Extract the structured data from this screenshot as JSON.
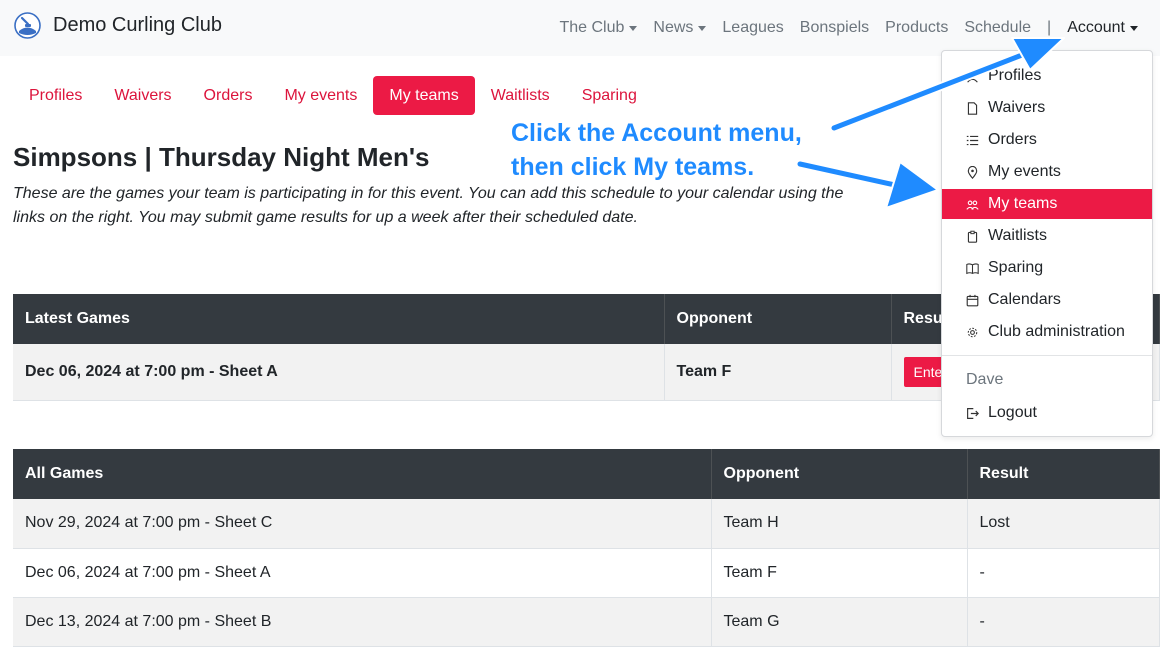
{
  "brand": {
    "name": "Demo Curling Club"
  },
  "topnav": {
    "items": [
      {
        "label": "The Club",
        "dropdown": true
      },
      {
        "label": "News",
        "dropdown": true
      },
      {
        "label": "Leagues",
        "dropdown": false
      },
      {
        "label": "Bonspiels",
        "dropdown": false
      },
      {
        "label": "Products",
        "dropdown": false
      },
      {
        "label": "Schedule",
        "dropdown": false
      }
    ],
    "separator": "|",
    "account_label": "Account"
  },
  "tabs": [
    {
      "label": "Profiles",
      "active": false
    },
    {
      "label": "Waivers",
      "active": false
    },
    {
      "label": "Orders",
      "active": false
    },
    {
      "label": "My events",
      "active": false
    },
    {
      "label": "My teams",
      "active": true
    },
    {
      "label": "Waitlists",
      "active": false
    },
    {
      "label": "Sparing",
      "active": false
    }
  ],
  "page": {
    "title": "Simpsons | Thursday Night Men's",
    "description": "These are the games your team is participating in for this event. You can add this schedule to your calendar using the links on the right. You may submit game results for up a week after their scheduled date."
  },
  "latest_games": {
    "headers": [
      "Latest Games",
      "Opponent",
      "Result"
    ],
    "rows": [
      {
        "game": "Dec 06, 2024 at 7:00 pm - Sheet A",
        "opponent": "Team F",
        "result_button": "Enter result"
      }
    ]
  },
  "all_games": {
    "headers": [
      "All Games",
      "Opponent",
      "Result"
    ],
    "rows": [
      {
        "game": "Nov 29, 2024 at 7:00 pm - Sheet C",
        "opponent": "Team H",
        "result": "Lost"
      },
      {
        "game": "Dec 06, 2024 at 7:00 pm - Sheet A",
        "opponent": "Team F",
        "result": "-"
      },
      {
        "game": "Dec 13, 2024 at 7:00 pm - Sheet B",
        "opponent": "Team G",
        "result": "-"
      }
    ]
  },
  "account_menu": {
    "items": [
      {
        "label": "Profiles",
        "icon": "person-icon",
        "active": false
      },
      {
        "label": "Waivers",
        "icon": "file-icon",
        "active": false
      },
      {
        "label": "Orders",
        "icon": "list-icon",
        "active": false
      },
      {
        "label": "My events",
        "icon": "location-pin-icon",
        "active": false
      },
      {
        "label": "My teams",
        "icon": "people-icon",
        "active": true
      },
      {
        "label": "Waitlists",
        "icon": "clipboard-icon",
        "active": false
      },
      {
        "label": "Sparing",
        "icon": "book-icon",
        "active": false
      },
      {
        "label": "Calendars",
        "icon": "calendar-icon",
        "active": false
      },
      {
        "label": "Club administration",
        "icon": "gear-icon",
        "active": false
      }
    ],
    "user_header": "Dave",
    "logout_label": "Logout",
    "logout_icon": "logout-icon"
  },
  "annotation": {
    "line1": "Click the Account menu,",
    "line2": "then click My teams.",
    "color": "#1f8bff"
  },
  "colors": {
    "accent": "#ec1a45",
    "table_header": "#343a40"
  }
}
